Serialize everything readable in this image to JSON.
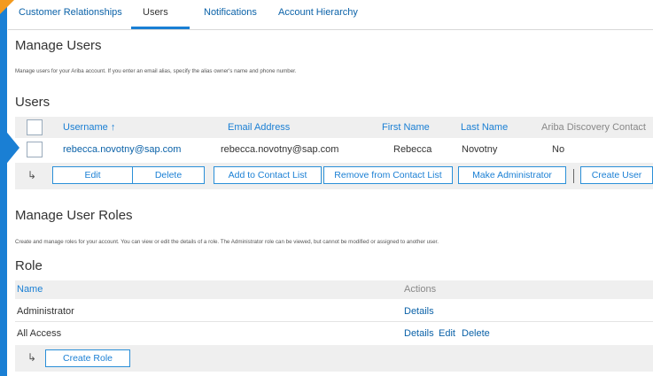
{
  "tabs": [
    {
      "label": "Customer Relationships"
    },
    {
      "label": "Users"
    },
    {
      "label": "Notifications"
    },
    {
      "label": "Account Hierarchy"
    }
  ],
  "manage_users": {
    "title": "Manage Users",
    "description": "Manage users for your Ariba account. If you enter an email alias, specify the alias owner's name and phone number."
  },
  "users": {
    "title": "Users",
    "columns": [
      "Username",
      "Email Address",
      "First Name",
      "Last Name",
      "Ariba Discovery Contact"
    ],
    "sort_glyph": "↑",
    "rows": [
      {
        "username": "rebecca.novotny@sap.com",
        "email": "rebecca.novotny@sap.com",
        "first_name": "Rebecca",
        "last_name": "Novotny",
        "discovery": "No"
      }
    ],
    "actions": {
      "edit": "Edit",
      "delete": "Delete",
      "add_contact": "Add to Contact List",
      "remove_contact": "Remove from Contact List",
      "make_admin": "Make Administrator",
      "create_user": "Create User"
    }
  },
  "manage_roles": {
    "title": "Manage User Roles",
    "description": "Create and manage roles for your account. You can view or edit the details of a role. The Administrator role can be viewed, but cannot be modified or assigned to another user."
  },
  "roles": {
    "title": "Role",
    "columns": [
      "Name",
      "Actions"
    ],
    "rows": [
      {
        "name": "Administrator",
        "details": "Details"
      },
      {
        "name": "All Access",
        "details": "Details",
        "edit": "Edit",
        "delete": "Delete"
      }
    ],
    "create_role": "Create Role"
  },
  "icons": {
    "return_arrow": "↳"
  },
  "colors": {
    "accent": "#1a7fd4",
    "link": "#0b62a8",
    "corner": "#f39a1e"
  }
}
